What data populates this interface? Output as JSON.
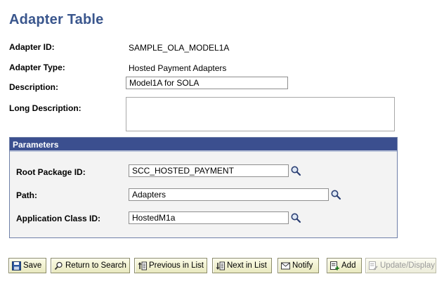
{
  "page": {
    "title": "Adapter Table"
  },
  "fields": {
    "adapter_id": {
      "label": "Adapter ID:",
      "value": "SAMPLE_OLA_MODEL1A"
    },
    "adapter_type": {
      "label": "Adapter Type:",
      "value": "Hosted Payment Adapters"
    },
    "description": {
      "label": "Description:",
      "value": "Model1A for SOLA"
    },
    "long_description": {
      "label": "Long Description:",
      "value": ""
    }
  },
  "parameters": {
    "header": "Parameters",
    "root_package_id": {
      "label": "Root Package ID:",
      "value": "SCC_HOSTED_PAYMENT"
    },
    "path": {
      "label": "Path:",
      "value": "Adapters"
    },
    "application_class_id": {
      "label": "Application Class ID:",
      "value": "HostedM1a"
    }
  },
  "toolbar": {
    "save": "Save",
    "return_to_search": "Return to Search",
    "previous_in_list": "Previous in List",
    "next_in_list": "Next in List",
    "notify": "Notify",
    "add": "Add",
    "update_display": "Update/Display"
  },
  "colors": {
    "title": "#3a568d",
    "group_header": "#3b4f8f",
    "button_bg": "#f2f2d0"
  },
  "icons": {
    "lookup": "magnifier-icon",
    "save": "floppy-disk-icon",
    "return_to_search": "search-icon",
    "previous_in_list": "previous-list-icon",
    "next_in_list": "next-list-icon",
    "notify": "notify-icon",
    "add": "add-icon",
    "update_display": "update-display-icon"
  }
}
